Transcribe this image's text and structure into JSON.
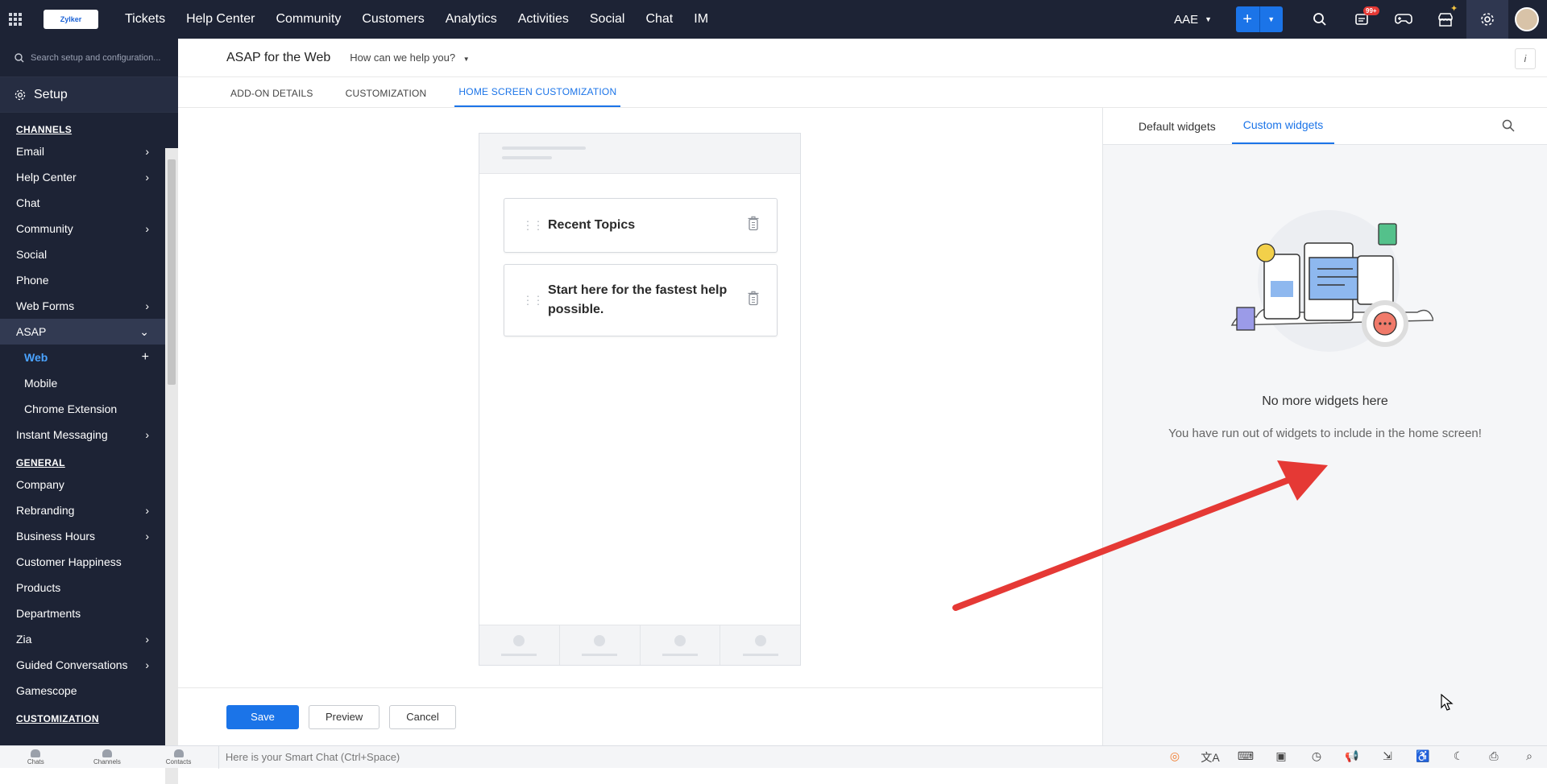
{
  "topbar": {
    "logo_text": "Zylker",
    "nav": [
      "Tickets",
      "Help Center",
      "Community",
      "Customers",
      "Analytics",
      "Activities",
      "Social",
      "Chat",
      "IM"
    ],
    "org": "AAE",
    "notification_badge": "99+"
  },
  "sidebar": {
    "search_placeholder": "Search setup and configuration...",
    "setup_label": "Setup",
    "channels_heading": "CHANNELS",
    "channels": [
      {
        "label": "Email",
        "arrow": "›"
      },
      {
        "label": "Help Center",
        "arrow": "›"
      },
      {
        "label": "Chat",
        "arrow": ""
      },
      {
        "label": "Community",
        "arrow": "›"
      },
      {
        "label": "Social",
        "arrow": ""
      },
      {
        "label": "Phone",
        "arrow": ""
      },
      {
        "label": "Web Forms",
        "arrow": "›"
      },
      {
        "label": "ASAP",
        "arrow": "⌄"
      }
    ],
    "asap_sub": [
      {
        "label": "Web",
        "action": "+"
      },
      {
        "label": "Mobile",
        "action": ""
      },
      {
        "label": "Chrome Extension",
        "action": ""
      }
    ],
    "instant_messaging": "Instant Messaging",
    "general_heading": "GENERAL",
    "general": [
      {
        "label": "Company",
        "arrow": ""
      },
      {
        "label": "Rebranding",
        "arrow": "›"
      },
      {
        "label": "Business Hours",
        "arrow": "›"
      },
      {
        "label": "Customer Happiness",
        "arrow": ""
      },
      {
        "label": "Products",
        "arrow": ""
      },
      {
        "label": "Departments",
        "arrow": ""
      },
      {
        "label": "Zia",
        "arrow": "›"
      },
      {
        "label": "Guided Conversations",
        "arrow": "›"
      },
      {
        "label": "Gamescope",
        "arrow": ""
      }
    ],
    "customization_heading": "CUSTOMIZATION"
  },
  "header": {
    "title": "ASAP for the Web",
    "dropdown": "How can we help you?",
    "info": "i"
  },
  "tabs": [
    "ADD-ON DETAILS",
    "CUSTOMIZATION",
    "HOME SCREEN CUSTOMIZATION"
  ],
  "phone": {
    "widgets": [
      "Recent Topics",
      "Start here for the fastest help possible."
    ]
  },
  "footer": {
    "save": "Save",
    "preview": "Preview",
    "cancel": "Cancel"
  },
  "right_panel": {
    "tabs": [
      "Default widgets",
      "Custom widgets"
    ],
    "empty_title": "No more widgets here",
    "empty_sub": "You have run out of widgets to include in the home screen!"
  },
  "bottombar": {
    "items": [
      "Chats",
      "Channels",
      "Contacts"
    ],
    "smart_chat": "Here is your Smart Chat (Ctrl+Space)"
  },
  "colors": {
    "accent": "#1b74e8",
    "sidebar_bg": "#1d2335",
    "arrow": "#e53935"
  }
}
